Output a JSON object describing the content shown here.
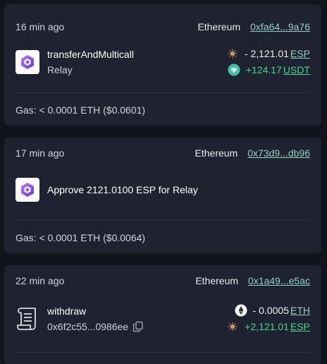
{
  "transactions": [
    {
      "time": "16 min ago",
      "network": "Ethereum",
      "hash": "0xfa64...9a76",
      "method": "transferAndMulticall",
      "app": "Relay",
      "amounts": [
        {
          "value": "- 2,121.01",
          "symbol": "ESP",
          "icon": "esp-token-icon"
        },
        {
          "value": "+124.17",
          "symbol": "USDT",
          "icon": "usdt-token-icon"
        }
      ],
      "gas": "Gas: < 0.0001 ETH ($0.0601)"
    },
    {
      "time": "17 min ago",
      "network": "Ethereum",
      "hash": "0x73d9...db96",
      "description": "Approve 2121.0100 ESP for Relay",
      "gas": "Gas: < 0.0001 ETH ($0.0064)"
    },
    {
      "time": "22 min ago",
      "network": "Ethereum",
      "hash": "0x1a49...e5ac",
      "method": "withdraw",
      "address": "0x6f2c55...0986ee",
      "amounts": [
        {
          "value": "- 0.0005",
          "symbol": "ETH",
          "icon": "eth-token-icon"
        },
        {
          "value": "+2,121.01",
          "symbol": "ESP",
          "icon": "esp-token-icon"
        }
      ]
    }
  ],
  "colors": {
    "background": "#12141d",
    "card": "#1f2230",
    "link": "#8fd1c4",
    "positive": "#3dd88d"
  }
}
